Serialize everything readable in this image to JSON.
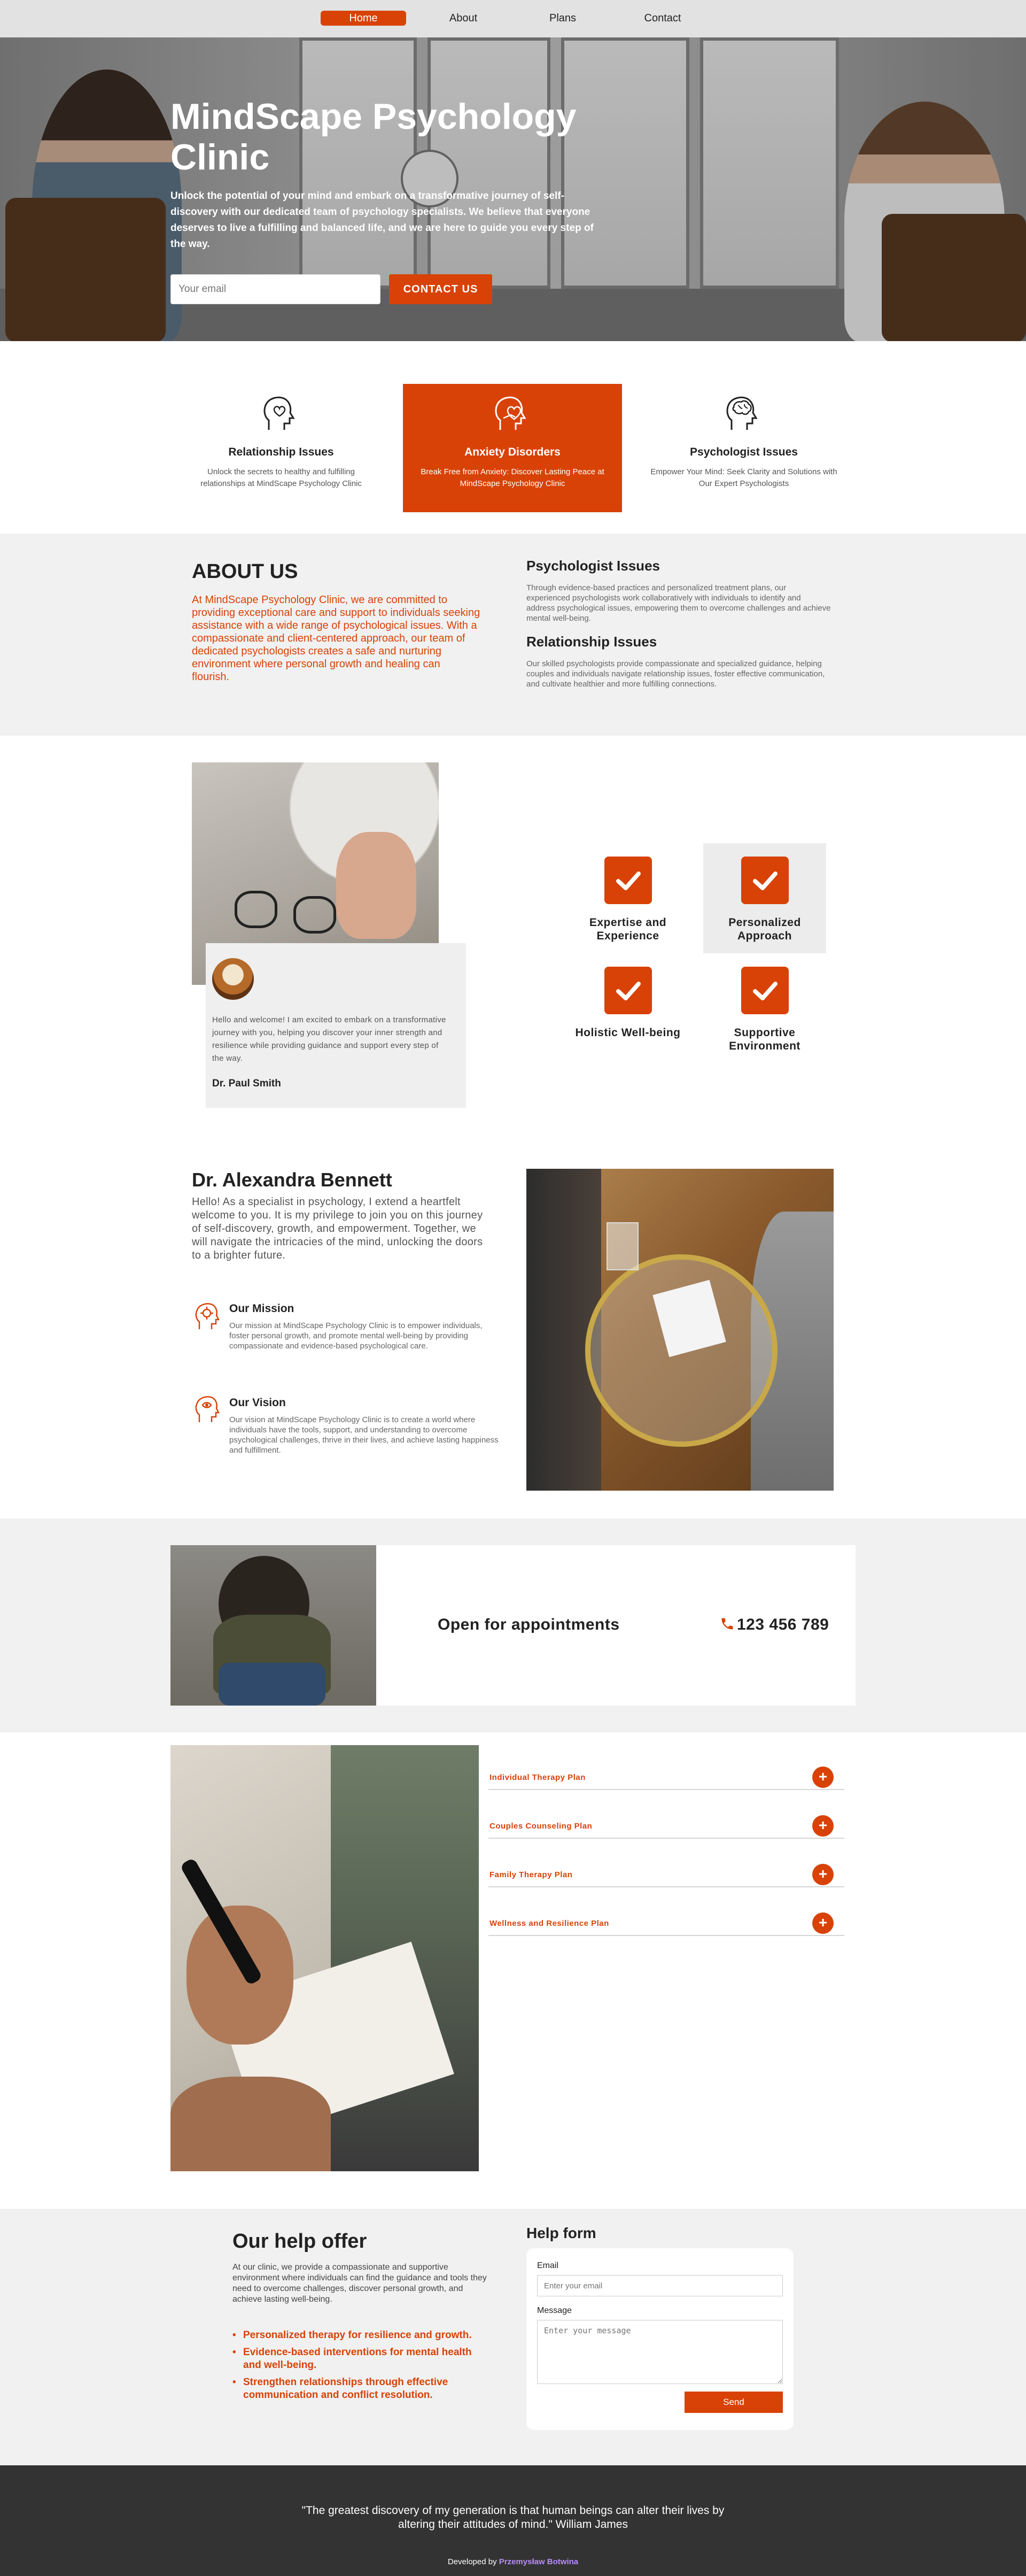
{
  "nav": {
    "items": [
      "Home",
      "About",
      "Plans",
      "Contact"
    ],
    "active": "Home"
  },
  "hero": {
    "title": "MindScape Psychology Clinic",
    "text": "Unlock the potential of your mind and embark on a transformative journey of self-discovery with our dedicated team of psychology specialists. We believe that everyone deserves to live a fulfilling and balanced life, and we are here to guide you every step of the way.",
    "email_placeholder": "Your email",
    "button_label": "CONTACT US"
  },
  "features": [
    {
      "icon": "relationship-heads-icon",
      "title": "Relationship Issues",
      "text": "Unlock the secrets to healthy and fulfilling relationships at MindScape Psychology Clinic",
      "active": false
    },
    {
      "icon": "anxiety-hand-heart-icon",
      "title": "Anxiety Disorders",
      "text": "Break Free from Anxiety: Discover Lasting Peace at MindScape Psychology Clinic",
      "active": true
    },
    {
      "icon": "brain-head-icon",
      "title": "Psychologist Issues",
      "text": "Empower Your Mind: Seek Clarity and Solutions with Our Expert Psychologists",
      "active": false
    }
  ],
  "about": {
    "title": "ABOUT US",
    "text": "At MindScape Psychology Clinic, we are committed to providing exceptional care and support to individuals seeking assistance with a wide range of psychological issues. With a compassionate and client-centered approach, our team of dedicated psychologists creates a safe and nurturing environment where personal growth and healing can flourish.",
    "blocks": [
      {
        "title": "Psychologist Issues",
        "text": "Through evidence-based practices and personalized treatment plans, our experienced psychologists work collaboratively with individuals to identify and address psychological issues, empowering them to overcome challenges and achieve mental well-being."
      },
      {
        "title": "Relationship Issues",
        "text": "Our skilled psychologists provide compassionate and specialized guidance, helping couples and individuals navigate relationship issues, foster effective communication, and cultivate healthier and more fulfilling connections."
      }
    ]
  },
  "intro": {
    "text": "Hello and welcome! I am excited to embark on a transformative journey with you, helping you discover your inner strength and resilience while providing guidance and support every step of the way.",
    "signature": "Dr. Paul Smith"
  },
  "checks": [
    {
      "label": "Expertise and Experience",
      "shaded": false
    },
    {
      "label": "Personalized Approach",
      "shaded": true
    },
    {
      "label": "Holistic Well-being",
      "shaded": false
    },
    {
      "label": "Supportive Environment",
      "shaded": false
    }
  ],
  "doctor": {
    "name": "Dr. Alexandra Bennett",
    "text": "Hello! As a specialist in psychology, I extend a heartfelt welcome to you. It is my privilege to join you on this journey of self-discovery, growth, and empowerment. Together, we will navigate the intricacies of the mind, unlocking the doors to a brighter future.",
    "mission": {
      "title": "Our Mission",
      "text": "Our mission at MindScape Psychology Clinic is to empower individuals, foster personal growth, and promote mental well-being by providing compassionate and evidence-based psychological care."
    },
    "vision": {
      "title": "Our Vision",
      "text": "Our vision at MindScape Psychology Clinic is to create a world where individuals have the tools, support, and understanding to overcome psychological challenges, thrive in their lives, and achieve lasting happiness and fulfillment."
    }
  },
  "appointments": {
    "label": "Open for appointments",
    "phone": "123 456 789"
  },
  "plans": [
    "Individual Therapy Plan",
    "Couples Counseling Plan",
    "Family Therapy Plan",
    "Wellness and Resilience Plan"
  ],
  "help": {
    "title": "Our help offer",
    "text": "At our clinic, we provide a compassionate and supportive environment where individuals can find the guidance and tools they need to overcome challenges, discover personal growth, and achieve lasting well-being.",
    "items": [
      "Personalized therapy for resilience and growth.",
      "Evidence-based interventions for mental health and well-being.",
      "Strengthen relationships through effective communication and conflict resolution."
    ]
  },
  "form": {
    "title": "Help form",
    "email_label": "Email",
    "email_placeholder": "Enter your email",
    "message_label": "Message",
    "message_placeholder": "Enter your message",
    "send_label": "Send"
  },
  "footer": {
    "quote": "\"The greatest discovery of my generation is that human beings can alter their lives by altering their attitudes of mind.\" William James",
    "credit_prefix": "Developed by",
    "credit_name": "Przemysław Botwina"
  },
  "colors": {
    "accent": "#d84207",
    "nav_bg": "#e2e2e2",
    "section_bg": "#f1f1f1",
    "footer_bg": "#333333"
  }
}
